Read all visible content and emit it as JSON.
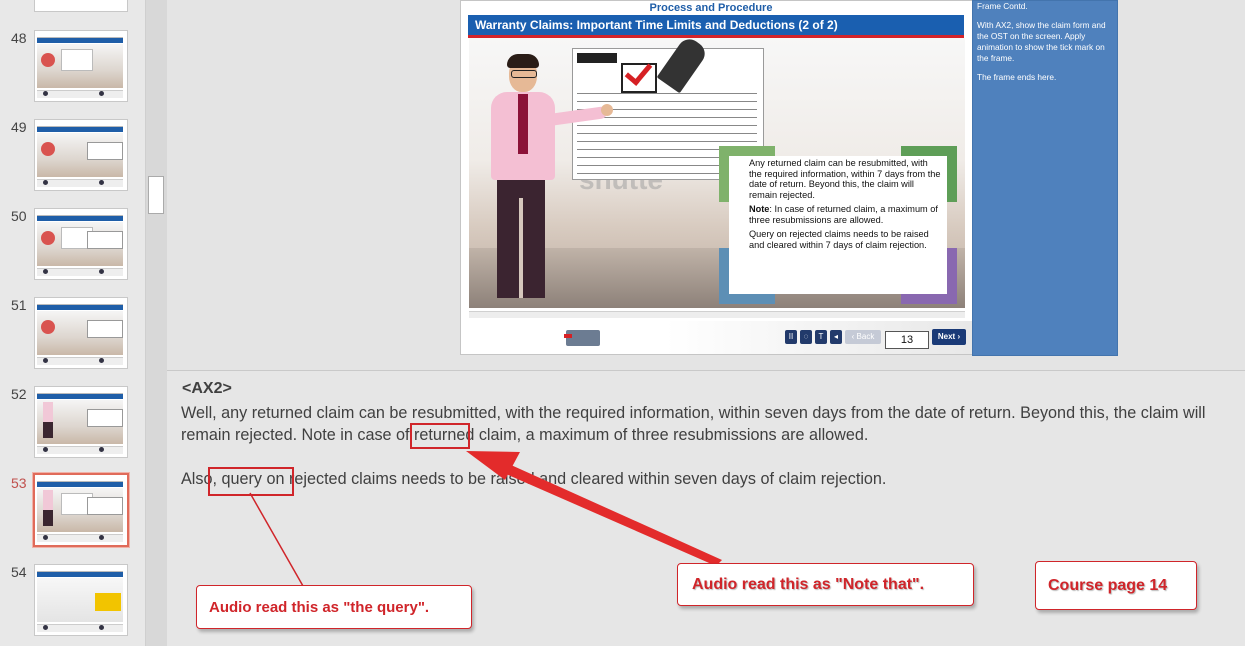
{
  "thumbnails": [
    {
      "number": "48",
      "active": false
    },
    {
      "number": "49",
      "active": false
    },
    {
      "number": "50",
      "active": false
    },
    {
      "number": "51",
      "active": false
    },
    {
      "number": "52",
      "active": false
    },
    {
      "number": "53",
      "active": true
    },
    {
      "number": "54",
      "active": false
    }
  ],
  "slide": {
    "section_heading": "Process and Procedure",
    "title": "Warranty Claims: Important Time Limits and Deductions (2 of 2)",
    "watermark": "shutte",
    "info_box": {
      "para1": "Any returned claim can be resubmitted, with the required information, within 7 days from the date of return. Beyond this, the claim will remain rejected.",
      "para2_label": "Note",
      "para2_text": ": In case of returned claim, a maximum of three resubmissions are allowed.",
      "para3": "Query on rejected claims needs to be raised and cleared within 7 days of claim rejection."
    },
    "footer": {
      "page_number": "13",
      "back_label": "‹ Back",
      "next_label": "Next ›",
      "controls": [
        "II",
        "◌",
        "T",
        "◂"
      ]
    }
  },
  "dev_notes": {
    "line1": "Frame Contd.",
    "line2": "With AX2, show the claim form and the OST on the screen. Apply animation to show the tick mark on the frame.",
    "line3": "The frame ends here."
  },
  "speaker_notes": {
    "tag": "<AX2>",
    "paragraph1": "Well, any returned claim can be resubmitted, with the required information, within seven days from the date of return. Beyond this, the claim will remain rejected. Note in case of returned claim, a maximum of three resubmissions are allowed.",
    "paragraph2": "Also, query on rejected claims needs to be raised and cleared within seven days of claim rejection."
  },
  "annotations": {
    "query_callout": "Audio read this as \"the query\".",
    "note_callout": "Audio read this as \"Note that\".",
    "page_callout": "Course page 14"
  },
  "colors": {
    "accent_blue": "#1a5fb0",
    "notes_panel": "#4f81bd",
    "annotation_red": "#d0252a",
    "active_thumb_border": "#e06b5a"
  }
}
